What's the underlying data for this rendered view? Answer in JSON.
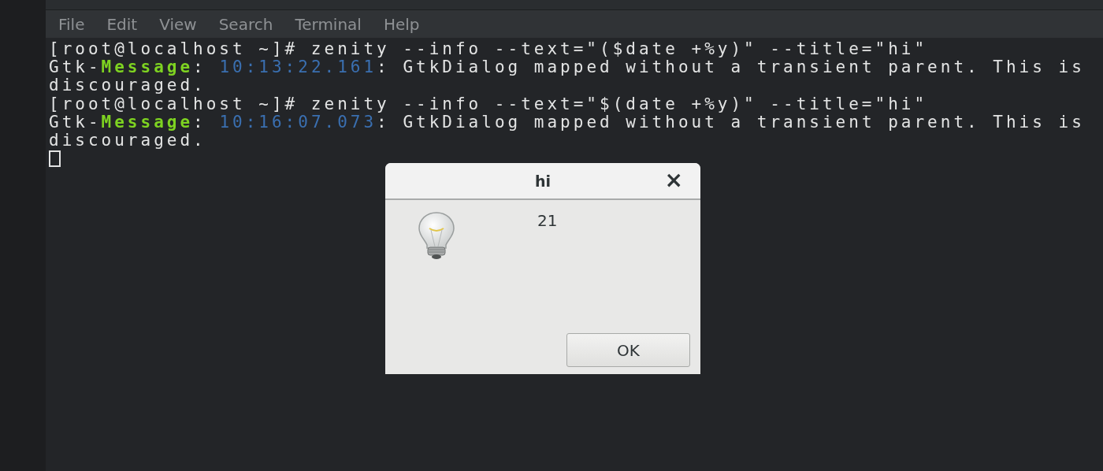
{
  "menu": [
    "File",
    "Edit",
    "View",
    "Search",
    "Terminal",
    "Help"
  ],
  "terminal": {
    "lines": [
      [
        {
          "kind": "plain",
          "text": "[root@localhost ~]# zenity --info --text=\"($date +%y)\" --title=\"hi\""
        }
      ],
      [
        {
          "kind": "plain",
          "text": "Gtk-"
        },
        {
          "kind": "keyword",
          "text": "Message"
        },
        {
          "kind": "plain",
          "text": ": "
        },
        {
          "kind": "time",
          "text": "10:13:22.161"
        },
        {
          "kind": "plain",
          "text": ": GtkDialog mapped without a transient parent. This is"
        }
      ],
      [
        {
          "kind": "plain",
          "text": "discouraged."
        }
      ],
      [
        {
          "kind": "plain",
          "text": "[root@localhost ~]# zenity --info --text=\"$(date +%y)\" --title=\"hi\""
        }
      ],
      [
        {
          "kind": "plain",
          "text": "Gtk-"
        },
        {
          "kind": "keyword",
          "text": "Message"
        },
        {
          "kind": "plain",
          "text": ": "
        },
        {
          "kind": "time",
          "text": "10:16:07.073"
        },
        {
          "kind": "plain",
          "text": ": GtkDialog mapped without a transient parent. This is"
        }
      ],
      [
        {
          "kind": "plain",
          "text": "discouraged."
        }
      ]
    ],
    "cursor": true
  },
  "dialog": {
    "title": "hi",
    "close": "×",
    "message": "21",
    "button": "OK"
  }
}
